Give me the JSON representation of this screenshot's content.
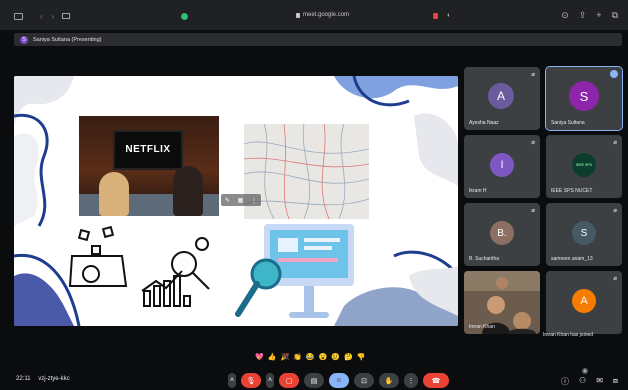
{
  "browser": {
    "url": "meet.google.com",
    "nav_back": "‹",
    "nav_forward": "›"
  },
  "presenting_bar": {
    "initial": "S",
    "label": "Saniya Sultana (Presenting)"
  },
  "slide": {
    "tv_text": "NETFLIX"
  },
  "participants": [
    {
      "name": "Ayesha Naaz",
      "initial": "A",
      "color": "#6c5b9c"
    },
    {
      "name": "Saniya Sultana",
      "initial": "S",
      "color": "#8e24aa"
    },
    {
      "name": "Ikram H",
      "initial": "I",
      "color": "#7e57c2"
    },
    {
      "name": "IEEE SPS NUCET",
      "initial": "IEEE SPS",
      "color": "#0d3d2a"
    },
    {
      "name": "B. Sucharitha",
      "initial": "B.",
      "color": "#8d6e63"
    },
    {
      "name": "samreen anam_13",
      "initial": "S",
      "color": "#455a64"
    },
    {
      "name": "Imran Khan",
      "initial": "",
      "color": "#6b5c4d"
    },
    {
      "name": "",
      "initial": "A",
      "color": "#f57c00"
    }
  ],
  "toast": "Imran Khan has joined",
  "reactions": [
    "💖",
    "👍",
    "🎉",
    "👏",
    "😂",
    "😮",
    "😢",
    "🤔",
    "👎"
  ],
  "meeting": {
    "time": "22:11",
    "code": "vzj-ztye-kkc"
  },
  "notification_count": "6",
  "colors": {
    "leave": "#ea4335",
    "accent": "#8ab4f8",
    "tile": "#3c4043"
  }
}
